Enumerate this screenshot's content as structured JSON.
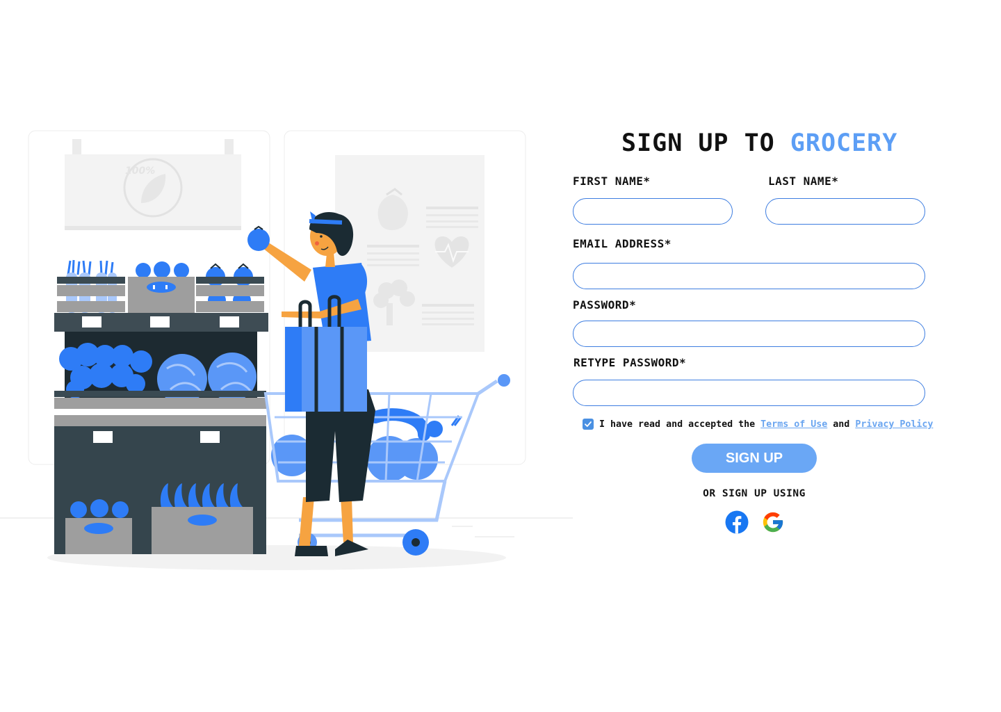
{
  "form": {
    "title_prefix": "SIGN UP TO",
    "title_brand": "GROCERY",
    "first_name_label": "FIRST NAME*",
    "last_name_label": "LAST NAME*",
    "email_label": "EMAIL ADDRESS*",
    "password_label": "PASSWORD*",
    "retype_label": "RETYPE PASSWORD*",
    "first_name_value": "",
    "last_name_value": "",
    "email_value": "",
    "password_value": "",
    "retype_value": "",
    "terms_text_1": "I have read and accepted the",
    "terms_link_1": "Terms of Use",
    "terms_text_2": "and",
    "terms_link_2": "Privacy Policy",
    "terms_checked": true,
    "signup_label": "SIGN UP",
    "or_text": "OR SIGN UP USING"
  },
  "social": {
    "facebook_icon": "facebook-icon",
    "google_icon": "google-icon"
  },
  "illustration": {
    "poster_badge": "100%"
  },
  "colors": {
    "accent": "#5c9ef5",
    "button": "#6aa7f5",
    "input_border": "#3d7de0",
    "facebook": "#1877f2"
  }
}
